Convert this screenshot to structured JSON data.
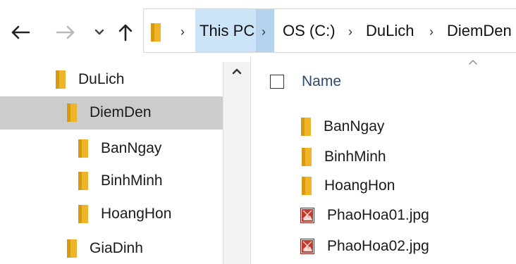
{
  "toolbar": {
    "back_icon": "back-arrow-icon",
    "forward_icon": "forward-arrow-icon",
    "recent_icon": "chevron-down-icon",
    "up_icon": "up-arrow-icon"
  },
  "breadcrumb": {
    "items": [
      "This PC",
      "OS (C:)",
      "DuLich",
      "DiemDen"
    ]
  },
  "tree": {
    "items": [
      {
        "label": "DuLich",
        "level": 0,
        "selected": false
      },
      {
        "label": "DiemDen",
        "level": 1,
        "selected": true
      },
      {
        "label": "BanNgay",
        "level": 2,
        "selected": false
      },
      {
        "label": "BinhMinh",
        "level": 2,
        "selected": false
      },
      {
        "label": "HoangHon",
        "level": 2,
        "selected": false
      },
      {
        "label": "GiaDinh",
        "level": 0,
        "selected": false
      }
    ]
  },
  "filelist": {
    "column_header": "Name",
    "items": [
      {
        "name": "BanNgay",
        "type": "folder"
      },
      {
        "name": "BinhMinh",
        "type": "folder"
      },
      {
        "name": "HoangHon",
        "type": "folder"
      },
      {
        "name": "PhaoHoa01.jpg",
        "type": "image"
      },
      {
        "name": "PhaoHoa02.jpg",
        "type": "image"
      }
    ]
  },
  "colors": {
    "folder": "#f0b429",
    "selection": "#cccccc",
    "breadcrumb_highlight": "#cce4f7",
    "header_text": "#2f4b6e",
    "image_icon": "#c0392b"
  }
}
